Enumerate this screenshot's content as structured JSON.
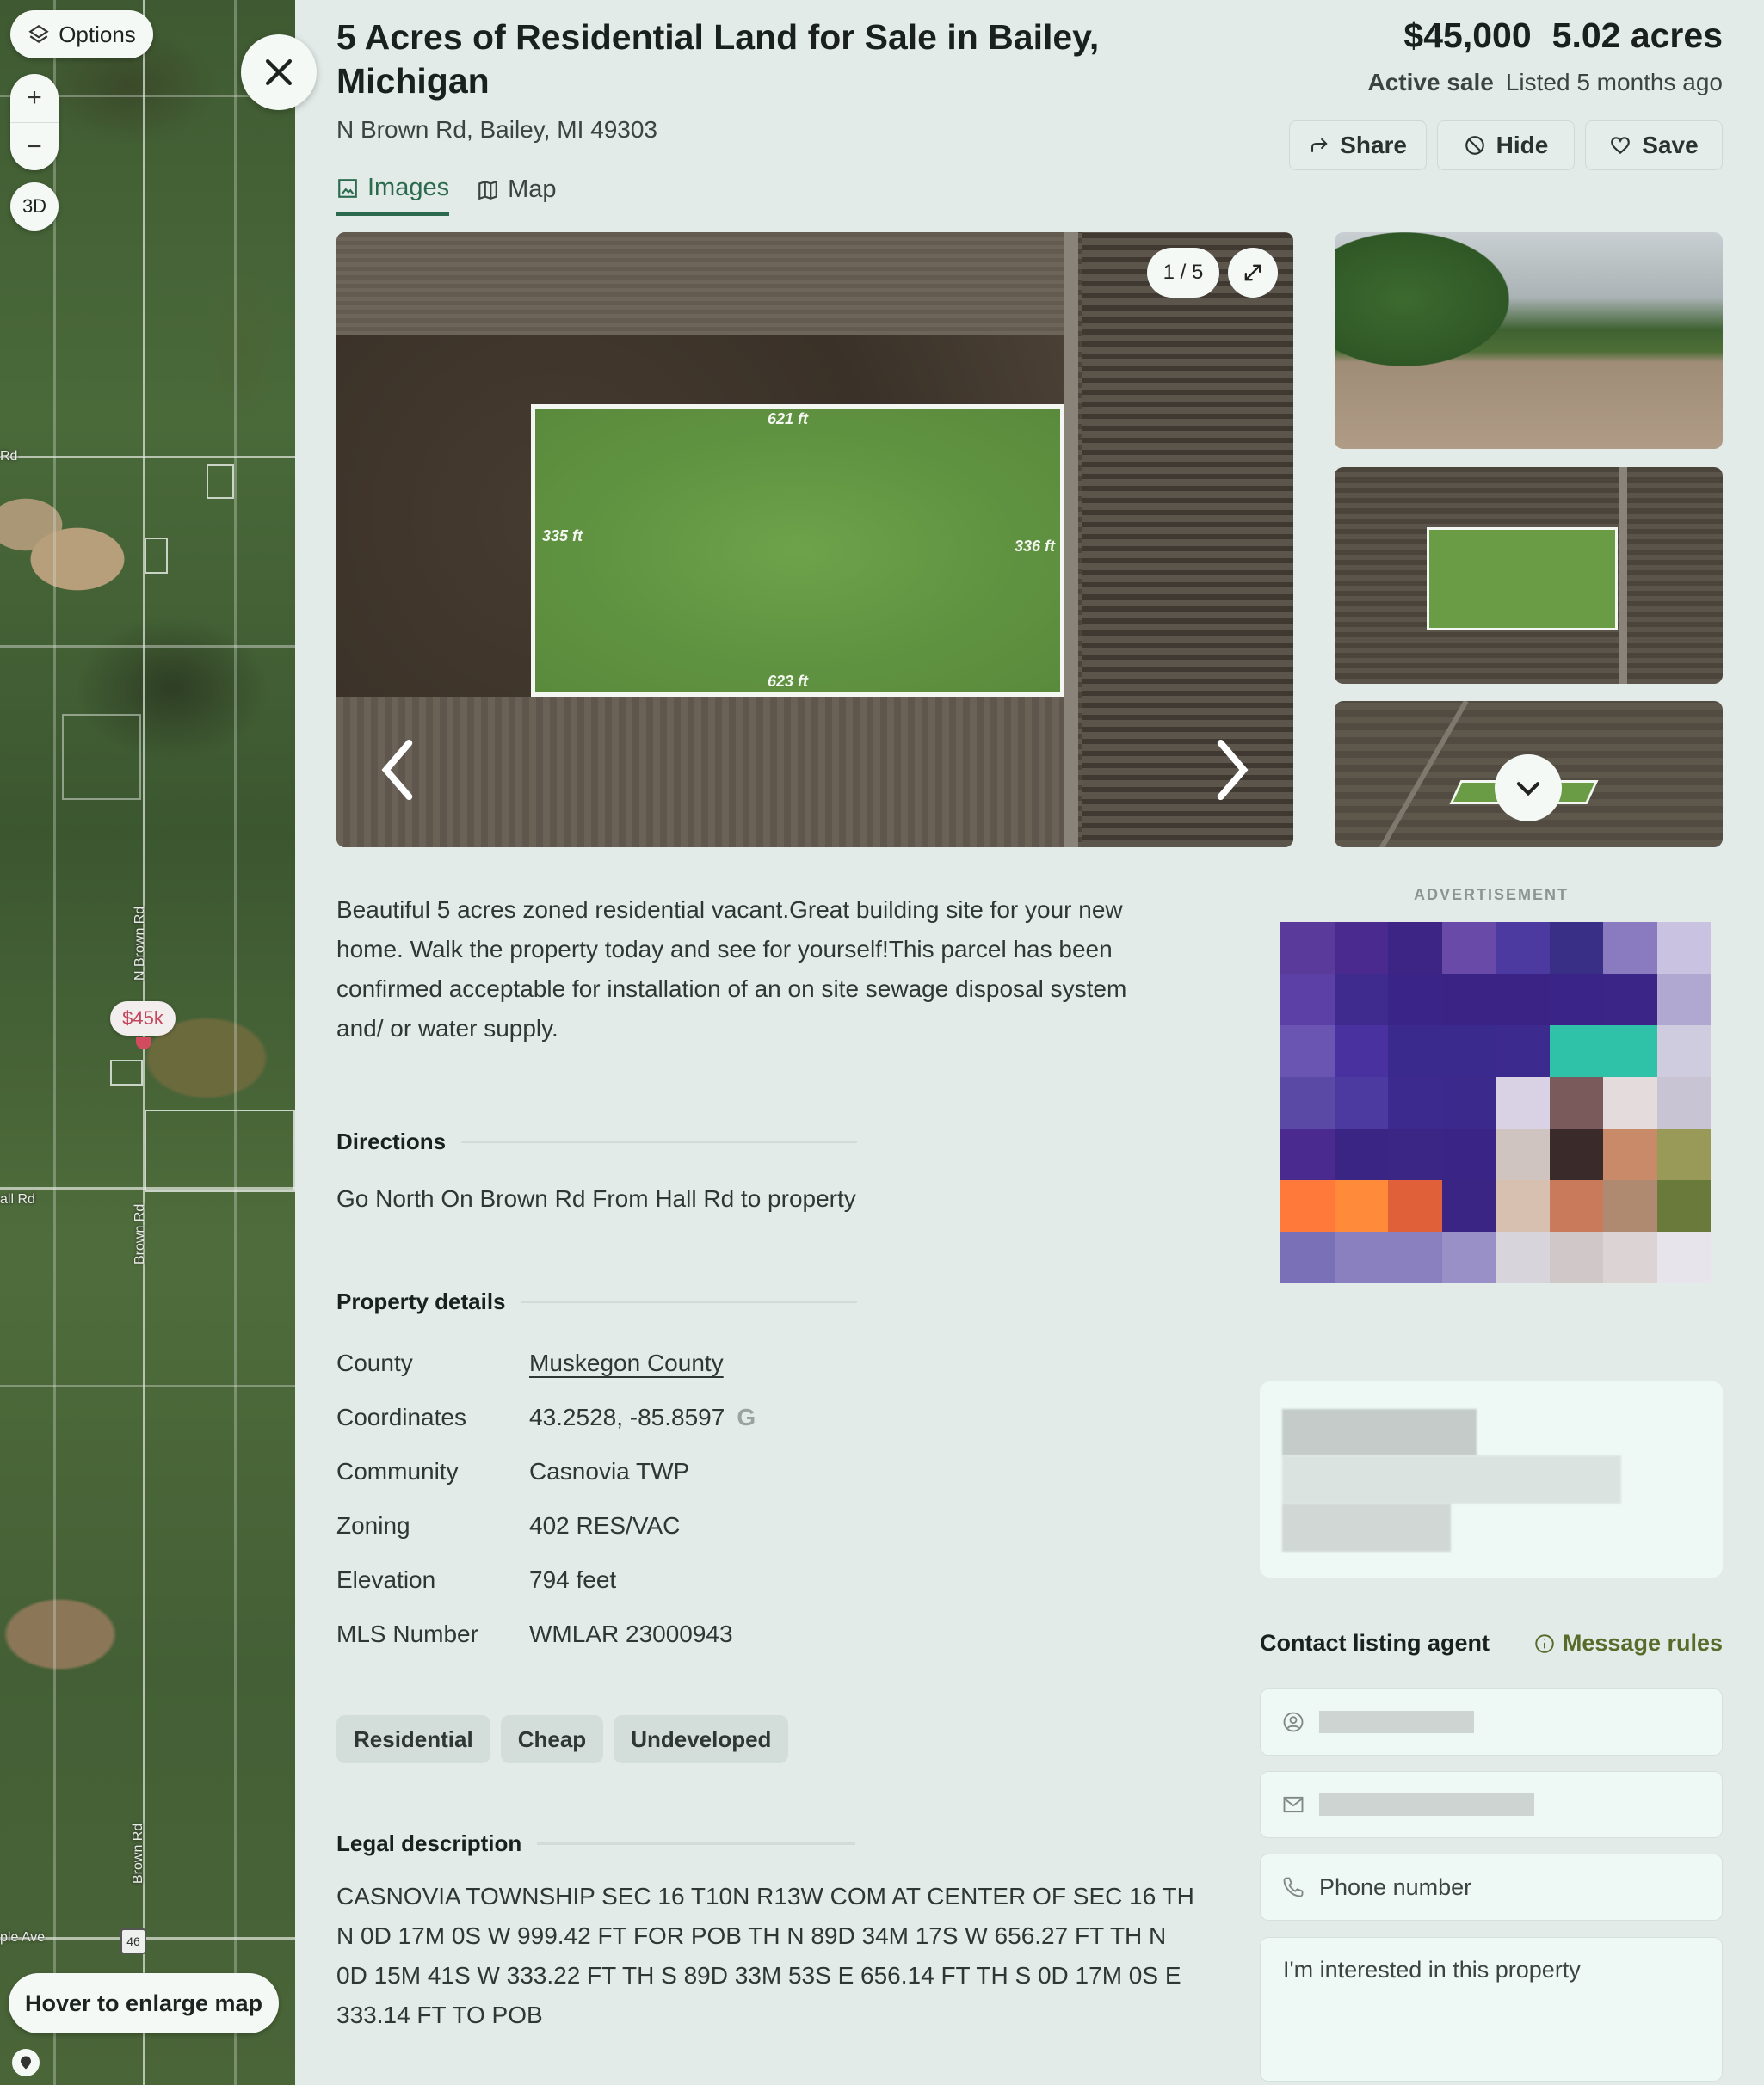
{
  "map": {
    "options_label": "Options",
    "zoom_in": "+",
    "zoom_out": "−",
    "btn_3d": "3D",
    "price_pin": "$45k",
    "road_labels": [
      "Rd",
      "N Brown Rd",
      "all Rd",
      "Brown Rd",
      "Brown Rd",
      "ple Ave"
    ],
    "highway_shield": "46",
    "hover_label": "Hover to enlarge map"
  },
  "listing": {
    "title": "5 Acres of Residential Land for Sale in Bailey, Michigan",
    "address": "N Brown Rd, Bailey, MI 49303",
    "price": "$45,000",
    "acreage": "5.02 acres",
    "status": "Active sale",
    "listed": "Listed 5 months ago"
  },
  "actions": {
    "share": "Share",
    "hide": "Hide",
    "save": "Save"
  },
  "tabs": [
    {
      "label": "Images",
      "active": true
    },
    {
      "label": "Map",
      "active": false
    }
  ],
  "gallery": {
    "counter": "1 / 5",
    "current": 1,
    "total": 5,
    "dimensions": {
      "top": "621 ft",
      "bottom": "623 ft",
      "left": "335 ft",
      "right": "336 ft"
    }
  },
  "description": "Beautiful 5 acres zoned residential vacant.Great building site for your new home. Walk the property today and see for yourself!This parcel has been confirmed acceptable for installation of an on site sewage disposal system and/ or water supply.",
  "directions": {
    "heading": "Directions",
    "text": "Go North On Brown Rd From Hall Rd to property"
  },
  "property_details": {
    "heading": "Property details",
    "rows": [
      {
        "label": "County",
        "value": "Muskegon County"
      },
      {
        "label": "Coordinates",
        "value": "43.2528, -85.8597"
      },
      {
        "label": "Community",
        "value": "Casnovia TWP"
      },
      {
        "label": "Zoning",
        "value": "402 RES/VAC"
      },
      {
        "label": "Elevation",
        "value": "794 feet"
      },
      {
        "label": "MLS Number",
        "value": "WMLAR 23000943"
      }
    ]
  },
  "tags": [
    "Residential",
    "Cheap",
    "Undeveloped"
  ],
  "legal": {
    "heading": "Legal description",
    "text": "CASNOVIA TOWNSHIP SEC 16 T10N R13W COM AT CENTER OF SEC 16 TH N 0D 17M 0S W 999.42 FT FOR POB TH N 89D 34M 17S W 656.27 FT TH N 0D 15M 41S W 333.22 FT TH S 89D 33M 53S E 656.14 FT TH S 0D 17M 0S E 333.14 FT TO POB"
  },
  "ad": {
    "label": "ADVERTISEMENT"
  },
  "contact": {
    "heading": "Contact listing agent",
    "message_rules": "Message rules",
    "phone_placeholder": "Phone number",
    "message_value": "I'm interested in this property"
  },
  "colors": {
    "accent": "#2c6a4f",
    "background": "#e2ebe8",
    "price_pin": "#c4475e",
    "message_rules": "#5a6a2a"
  }
}
